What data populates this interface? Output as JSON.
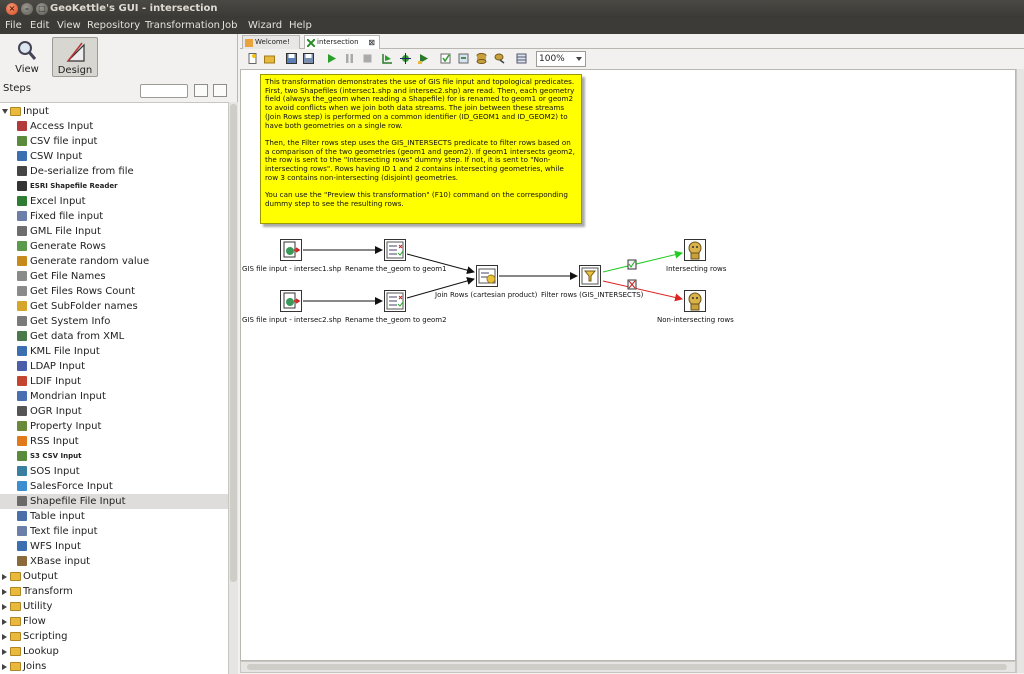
{
  "window": {
    "title": "GeoKettle's GUI - intersection",
    "close_glyph": "×",
    "min_glyph": "–",
    "max_glyph": "□"
  },
  "menu": [
    "File",
    "Edit",
    "View",
    "Repository",
    "Transformation",
    "Job",
    "Wizard",
    "Help"
  ],
  "perspectives": {
    "view": "View",
    "design": "Design"
  },
  "steps": {
    "label": "Steps",
    "search_placeholder": ""
  },
  "tree": [
    {
      "label": "Input",
      "type": "folder",
      "expanded": true
    },
    {
      "label": "Access Input",
      "type": "step",
      "color": "#b33a3a"
    },
    {
      "label": "CSV file input",
      "type": "step",
      "color": "#5a8b3c"
    },
    {
      "label": "CSW Input",
      "type": "step",
      "color": "#3b6fb0"
    },
    {
      "label": "De-serialize from file",
      "type": "step",
      "color": "#444444"
    },
    {
      "label": "ESRI Shapefile Reader",
      "type": "step",
      "color": "#333333",
      "small": true
    },
    {
      "label": "Excel Input",
      "type": "step",
      "color": "#2f7d32"
    },
    {
      "label": "Fixed file input",
      "type": "step",
      "color": "#6b7fa8"
    },
    {
      "label": "GML File Input",
      "type": "step",
      "color": "#6d6d6d"
    },
    {
      "label": "Generate Rows",
      "type": "step",
      "color": "#5a9a4a"
    },
    {
      "label": "Generate random value",
      "type": "step",
      "color": "#c78a1d"
    },
    {
      "label": "Get File Names",
      "type": "step",
      "color": "#8a8a8a"
    },
    {
      "label": "Get Files Rows Count",
      "type": "step",
      "color": "#8a8a8a"
    },
    {
      "label": "Get SubFolder names",
      "type": "step",
      "color": "#d4a72c"
    },
    {
      "label": "Get System Info",
      "type": "step",
      "color": "#7a7a7a"
    },
    {
      "label": "Get data from XML",
      "type": "step",
      "color": "#4a7a4a"
    },
    {
      "label": "KML File Input",
      "type": "step",
      "color": "#3b6fb0"
    },
    {
      "label": "LDAP Input",
      "type": "step",
      "color": "#4a5fa8"
    },
    {
      "label": "LDIF Input",
      "type": "step",
      "color": "#c4452f"
    },
    {
      "label": "Mondrian Input",
      "type": "step",
      "color": "#4a6fb0"
    },
    {
      "label": "OGR Input",
      "type": "step",
      "color": "#555555"
    },
    {
      "label": "Property Input",
      "type": "step",
      "color": "#6a8a3a"
    },
    {
      "label": "RSS Input",
      "type": "step",
      "color": "#e07a1a"
    },
    {
      "label": "S3 CSV Input",
      "type": "step",
      "color": "#5a8b3c",
      "small": true
    },
    {
      "label": "SOS Input",
      "type": "step",
      "color": "#3b7fa0"
    },
    {
      "label": "SalesForce Input",
      "type": "step",
      "color": "#3b8fd0"
    },
    {
      "label": "Shapefile File Input",
      "type": "step",
      "color": "#6a6a6a",
      "selected": true
    },
    {
      "label": "Table input",
      "type": "step",
      "color": "#4a6fa8"
    },
    {
      "label": "Text file input",
      "type": "step",
      "color": "#6b7fa8"
    },
    {
      "label": "WFS Input",
      "type": "step",
      "color": "#3b6fb0"
    },
    {
      "label": "XBase input",
      "type": "step",
      "color": "#8a6a3a"
    },
    {
      "label": "Output",
      "type": "folder",
      "expanded": false
    },
    {
      "label": "Transform",
      "type": "folder",
      "expanded": false
    },
    {
      "label": "Utility",
      "type": "folder",
      "expanded": false
    },
    {
      "label": "Flow",
      "type": "folder",
      "expanded": false
    },
    {
      "label": "Scripting",
      "type": "folder",
      "expanded": false
    },
    {
      "label": "Lookup",
      "type": "folder",
      "expanded": false
    },
    {
      "label": "Joins",
      "type": "folder",
      "expanded": false
    }
  ],
  "tabs": [
    {
      "label": "Welcome!",
      "active": false
    },
    {
      "label": "intersection",
      "active": true,
      "close_glyph": "⊠"
    }
  ],
  "toolbar": {
    "zoom": "100%",
    "icons": [
      "new-file-icon",
      "open-icon",
      "save-icon",
      "save-as-icon",
      "run-icon",
      "pause-icon",
      "stop-icon",
      "preview-icon",
      "debug-icon",
      "replay-icon",
      "verify-icon",
      "impact-icon",
      "sql-icon",
      "explore-db-icon",
      "show-results-icon"
    ]
  },
  "note": {
    "paragraphs": [
      "This transformation demonstrates the use of GIS file input and topological predicates. First, two Shapefiles (intersec1.shp and intersec2.shp) are read. Then, each geometry field (always the_geom when reading a Shapefile) for is renamed to geom1 or geom2 to avoid conflicts when we join both data streams. The join between these streams (Join Rows step) is performed on a common identifier (ID_GEOM1 and ID_GEOM2) to have both geometries on a single row.",
      "Then, the Filter rows step uses the GIS_INTERSECTS predicate to filter rows based on a comparison of the two geometries (geom1 and geom2). If geom1 intersects geom2, the row is sent to the \"Intersecting rows\" dummy step. If not, it is sent to \"Non-intersecting rows\". Rows having ID 1 and 2 contains intersecting geometries, while row 3 contains non-intersecting (disjoint) geometries.",
      "You can use the \"Preview this transformation\" (F10) command on the corresponding dummy step to see the resulting rows."
    ]
  },
  "flow": {
    "steps": {
      "gis1": "GIS file input - intersec1.shp",
      "gis2": "GIS file input - intersec2.shp",
      "rename1": "Rename the_geom to geom1",
      "rename2": "Rename the_geom to geom2",
      "join": "Join Rows (cartesian product)",
      "filter": "Filter rows (GIS_INTERSECTS)",
      "intersecting": "Intersecting rows",
      "nonintersecting": "Non-intersecting rows"
    },
    "colors": {
      "true_hop": "#22cc22",
      "false_hop": "#dd2222",
      "hop": "#111111"
    }
  }
}
